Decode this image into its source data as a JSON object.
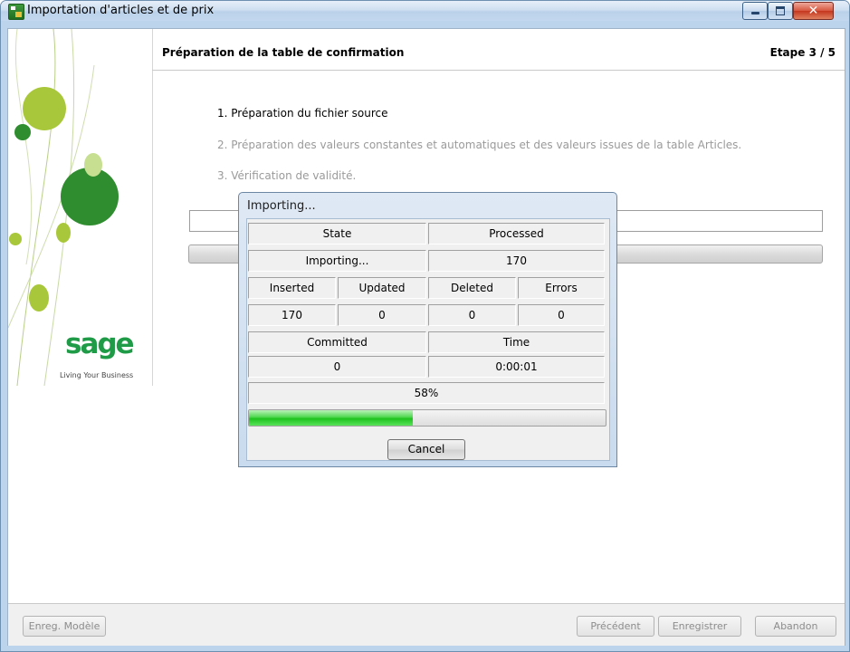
{
  "window": {
    "title": "Importation d'articles et de prix",
    "close_glyph": "✕"
  },
  "left_panel": {
    "logo_text": "sage",
    "tagline": "Living Your Business",
    "colors": {
      "brand_green": "#1f9b47",
      "leaf_light": "#a9c73a",
      "leaf_dark": "#2f8c2f"
    }
  },
  "header": {
    "title": "Préparation de la table de confirmation",
    "step": "Etape  3 / 5"
  },
  "steps": [
    {
      "label": "1. Préparation du fichier source",
      "state": "active"
    },
    {
      "label": "2. Préparation des valeurs constantes et automatiques et des valeurs issues de la table Articles.",
      "state": "pending"
    },
    {
      "label": "3. Vérification de validité.",
      "state": "pending"
    }
  ],
  "footer": {
    "save_model": "Enreg. Modèle",
    "previous": "Précédent",
    "register": "Enregistrer",
    "abort": "Abandon"
  },
  "import_dialog": {
    "title": "Importing...",
    "state_header": "State",
    "processed_header": "Processed",
    "state_value": "Importing...",
    "processed_value": "170",
    "inserted_header": "Inserted",
    "updated_header": "Updated",
    "deleted_header": "Deleted",
    "errors_header": "Errors",
    "inserted_value": "170",
    "updated_value": "0",
    "deleted_value": "0",
    "errors_value": "0",
    "committed_header": "Committed",
    "time_header": "Time",
    "committed_value": "0",
    "time_value": "0:00:01",
    "progress_label": "58%",
    "progress_fraction": 0.46,
    "cancel_label": "Cancel"
  }
}
